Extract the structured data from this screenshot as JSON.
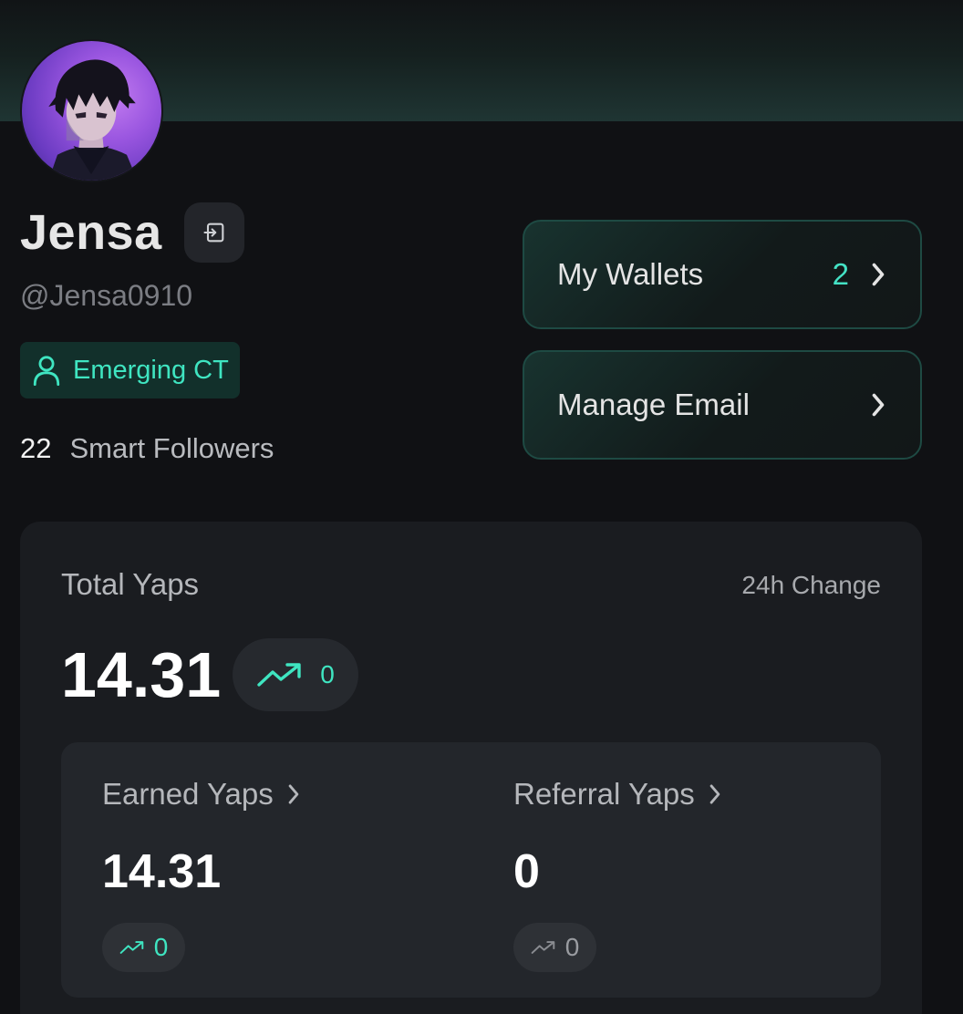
{
  "profile": {
    "name": "Jensa",
    "handle": "@Jensa0910",
    "badge": "Emerging CT",
    "smart_followers_count": "22",
    "smart_followers_label": "Smart Followers"
  },
  "actions": {
    "wallets_label": "My Wallets",
    "wallets_count": "2",
    "email_label": "Manage Email"
  },
  "yaps": {
    "total_label": "Total Yaps",
    "change_label": "24h Change",
    "total_value": "14.31",
    "total_change": "0",
    "earned_label": "Earned Yaps",
    "earned_value": "14.31",
    "earned_change": "0",
    "referral_label": "Referral Yaps",
    "referral_value": "0",
    "referral_change": "0"
  },
  "colors": {
    "accent": "#3fe5c1",
    "background": "#101114",
    "card": "#1a1c20",
    "muted_change": "#8a8c91"
  },
  "icons": [
    "logout-icon",
    "user-icon",
    "chevron-right-icon",
    "trending-up-icon"
  ]
}
